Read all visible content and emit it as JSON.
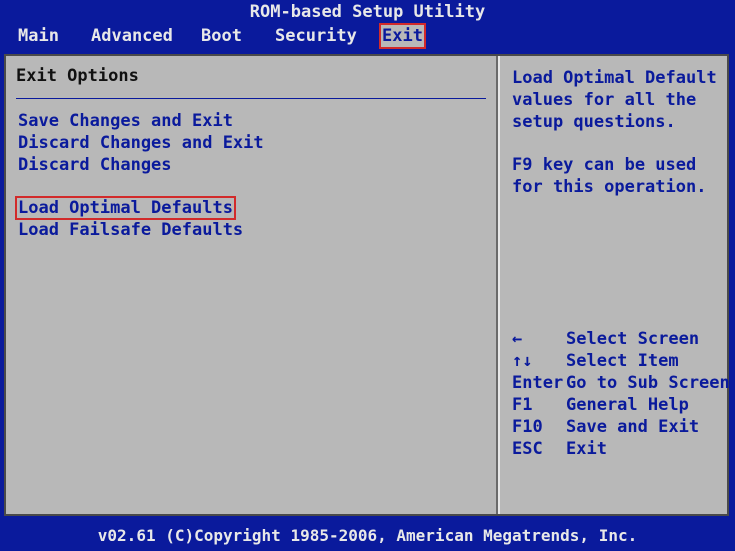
{
  "window": {
    "title": "ROM-based Setup Utility"
  },
  "menu": {
    "items": [
      {
        "label": "Main"
      },
      {
        "label": "Advanced"
      },
      {
        "label": "Boot"
      },
      {
        "label": "Security"
      },
      {
        "label": "Exit"
      }
    ],
    "active": "Exit"
  },
  "left_panel": {
    "title": "Exit Options",
    "options": [
      {
        "label": "Save Changes and Exit"
      },
      {
        "label": "Discard Changes and Exit"
      },
      {
        "label": "Discard Changes"
      },
      {
        "label": "Load Optimal Defaults"
      },
      {
        "label": "Load Failsafe Defaults"
      }
    ],
    "selected": "Load Optimal Defaults"
  },
  "help_panel": {
    "description_lines": [
      "Load Optimal Default",
      "values for all the",
      "setup questions."
    ],
    "hint_lines": [
      "F9 key can be used",
      "for this operation."
    ],
    "keys": [
      {
        "key": "←",
        "action": "Select Screen"
      },
      {
        "key": "↑↓",
        "action": "Select Item"
      },
      {
        "key": "Enter",
        "action": "Go to Sub Screen"
      },
      {
        "key": "F1",
        "action": "General Help"
      },
      {
        "key": "F10",
        "action": "Save and Exit"
      },
      {
        "key": "ESC",
        "action": "Exit"
      }
    ]
  },
  "footer": {
    "text": "v02.61 (C)Copyright 1985-2006, American Megatrends, Inc."
  },
  "colors": {
    "bios_blue": "#0a1a9c",
    "panel_gray": "#b8b8b8",
    "highlight_red": "#d22a2a"
  }
}
